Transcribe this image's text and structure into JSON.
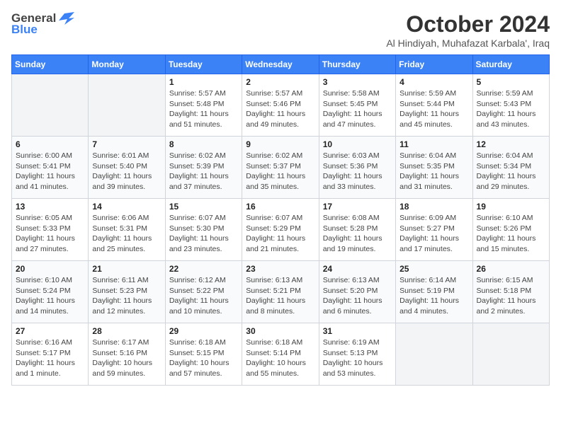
{
  "logo": {
    "general": "General",
    "blue": "Blue"
  },
  "header": {
    "month": "October 2024",
    "location": "Al Hindiyah, Muhafazat Karbala', Iraq"
  },
  "weekdays": [
    "Sunday",
    "Monday",
    "Tuesday",
    "Wednesday",
    "Thursday",
    "Friday",
    "Saturday"
  ],
  "weeks": [
    [
      {
        "day": "",
        "info": ""
      },
      {
        "day": "",
        "info": ""
      },
      {
        "day": "1",
        "info": "Sunrise: 5:57 AM\nSunset: 5:48 PM\nDaylight: 11 hours and 51 minutes."
      },
      {
        "day": "2",
        "info": "Sunrise: 5:57 AM\nSunset: 5:46 PM\nDaylight: 11 hours and 49 minutes."
      },
      {
        "day": "3",
        "info": "Sunrise: 5:58 AM\nSunset: 5:45 PM\nDaylight: 11 hours and 47 minutes."
      },
      {
        "day": "4",
        "info": "Sunrise: 5:59 AM\nSunset: 5:44 PM\nDaylight: 11 hours and 45 minutes."
      },
      {
        "day": "5",
        "info": "Sunrise: 5:59 AM\nSunset: 5:43 PM\nDaylight: 11 hours and 43 minutes."
      }
    ],
    [
      {
        "day": "6",
        "info": "Sunrise: 6:00 AM\nSunset: 5:41 PM\nDaylight: 11 hours and 41 minutes."
      },
      {
        "day": "7",
        "info": "Sunrise: 6:01 AM\nSunset: 5:40 PM\nDaylight: 11 hours and 39 minutes."
      },
      {
        "day": "8",
        "info": "Sunrise: 6:02 AM\nSunset: 5:39 PM\nDaylight: 11 hours and 37 minutes."
      },
      {
        "day": "9",
        "info": "Sunrise: 6:02 AM\nSunset: 5:37 PM\nDaylight: 11 hours and 35 minutes."
      },
      {
        "day": "10",
        "info": "Sunrise: 6:03 AM\nSunset: 5:36 PM\nDaylight: 11 hours and 33 minutes."
      },
      {
        "day": "11",
        "info": "Sunrise: 6:04 AM\nSunset: 5:35 PM\nDaylight: 11 hours and 31 minutes."
      },
      {
        "day": "12",
        "info": "Sunrise: 6:04 AM\nSunset: 5:34 PM\nDaylight: 11 hours and 29 minutes."
      }
    ],
    [
      {
        "day": "13",
        "info": "Sunrise: 6:05 AM\nSunset: 5:33 PM\nDaylight: 11 hours and 27 minutes."
      },
      {
        "day": "14",
        "info": "Sunrise: 6:06 AM\nSunset: 5:31 PM\nDaylight: 11 hours and 25 minutes."
      },
      {
        "day": "15",
        "info": "Sunrise: 6:07 AM\nSunset: 5:30 PM\nDaylight: 11 hours and 23 minutes."
      },
      {
        "day": "16",
        "info": "Sunrise: 6:07 AM\nSunset: 5:29 PM\nDaylight: 11 hours and 21 minutes."
      },
      {
        "day": "17",
        "info": "Sunrise: 6:08 AM\nSunset: 5:28 PM\nDaylight: 11 hours and 19 minutes."
      },
      {
        "day": "18",
        "info": "Sunrise: 6:09 AM\nSunset: 5:27 PM\nDaylight: 11 hours and 17 minutes."
      },
      {
        "day": "19",
        "info": "Sunrise: 6:10 AM\nSunset: 5:26 PM\nDaylight: 11 hours and 15 minutes."
      }
    ],
    [
      {
        "day": "20",
        "info": "Sunrise: 6:10 AM\nSunset: 5:24 PM\nDaylight: 11 hours and 14 minutes."
      },
      {
        "day": "21",
        "info": "Sunrise: 6:11 AM\nSunset: 5:23 PM\nDaylight: 11 hours and 12 minutes."
      },
      {
        "day": "22",
        "info": "Sunrise: 6:12 AM\nSunset: 5:22 PM\nDaylight: 11 hours and 10 minutes."
      },
      {
        "day": "23",
        "info": "Sunrise: 6:13 AM\nSunset: 5:21 PM\nDaylight: 11 hours and 8 minutes."
      },
      {
        "day": "24",
        "info": "Sunrise: 6:13 AM\nSunset: 5:20 PM\nDaylight: 11 hours and 6 minutes."
      },
      {
        "day": "25",
        "info": "Sunrise: 6:14 AM\nSunset: 5:19 PM\nDaylight: 11 hours and 4 minutes."
      },
      {
        "day": "26",
        "info": "Sunrise: 6:15 AM\nSunset: 5:18 PM\nDaylight: 11 hours and 2 minutes."
      }
    ],
    [
      {
        "day": "27",
        "info": "Sunrise: 6:16 AM\nSunset: 5:17 PM\nDaylight: 11 hours and 1 minute."
      },
      {
        "day": "28",
        "info": "Sunrise: 6:17 AM\nSunset: 5:16 PM\nDaylight: 10 hours and 59 minutes."
      },
      {
        "day": "29",
        "info": "Sunrise: 6:18 AM\nSunset: 5:15 PM\nDaylight: 10 hours and 57 minutes."
      },
      {
        "day": "30",
        "info": "Sunrise: 6:18 AM\nSunset: 5:14 PM\nDaylight: 10 hours and 55 minutes."
      },
      {
        "day": "31",
        "info": "Sunrise: 6:19 AM\nSunset: 5:13 PM\nDaylight: 10 hours and 53 minutes."
      },
      {
        "day": "",
        "info": ""
      },
      {
        "day": "",
        "info": ""
      }
    ]
  ]
}
